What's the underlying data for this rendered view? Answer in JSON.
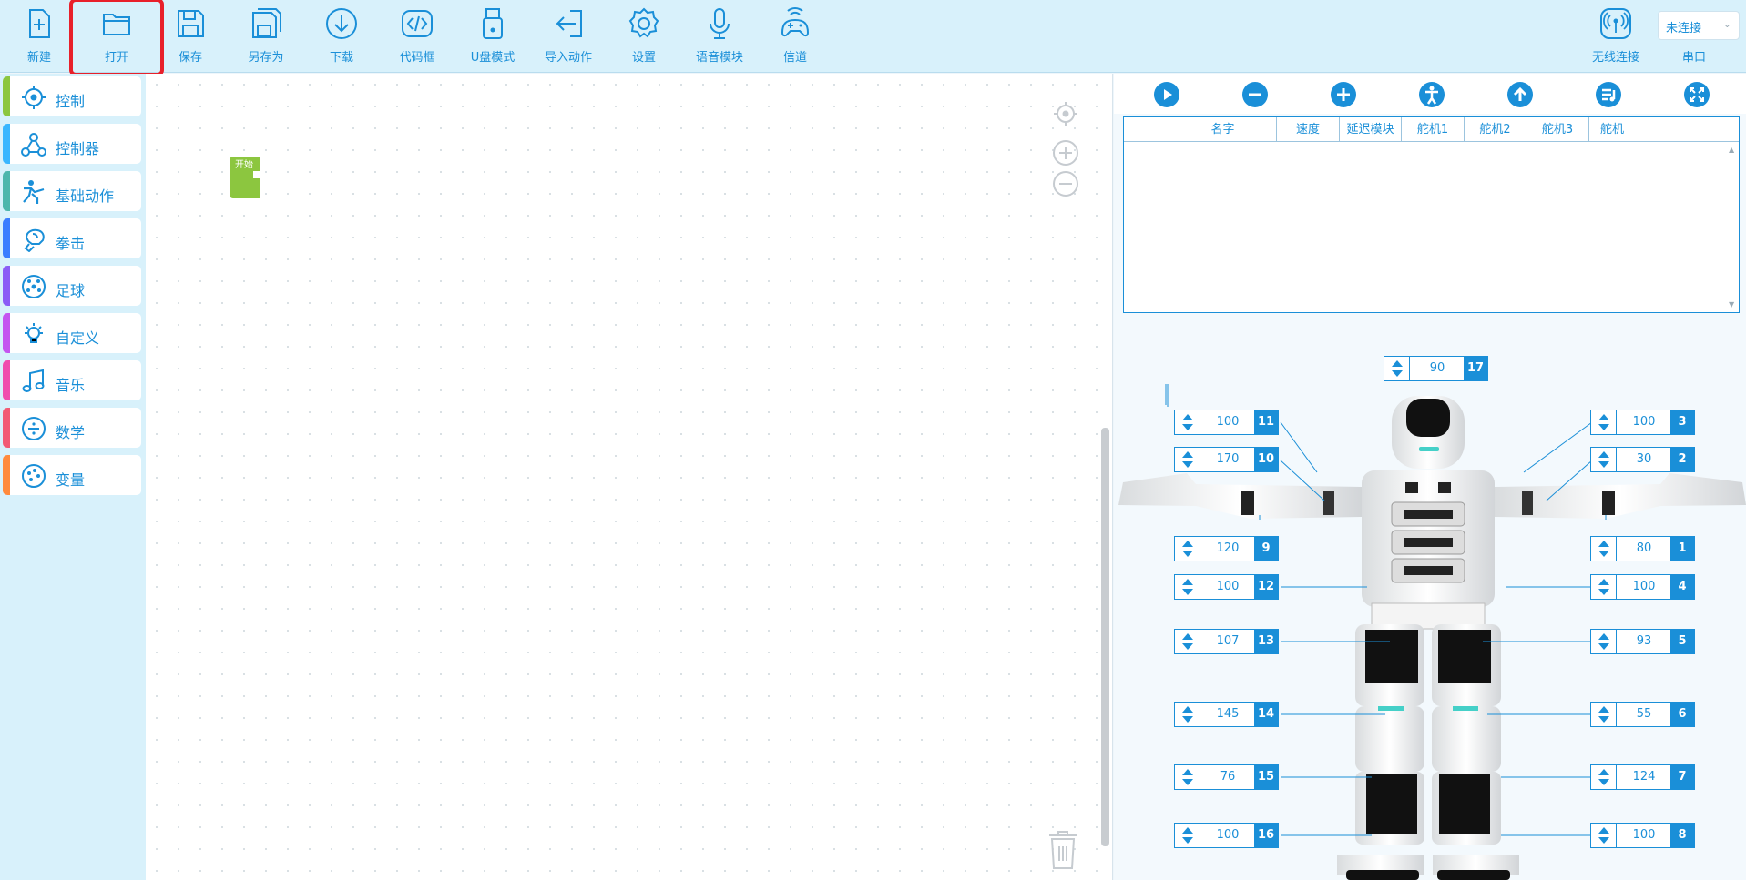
{
  "toolbar": {
    "new_label": "新建",
    "open_label": "打开",
    "save_label": "保存",
    "save_as_label": "另存为",
    "download_label": "下载",
    "code_label": "代码框",
    "usb_label": "U盘模式",
    "import_label": "导入动作",
    "settings_label": "设置",
    "voice_label": "语音模块",
    "channel_label": "信道",
    "wireless_label": "无线连接",
    "connection_value": "未连接",
    "serial_label": "串口"
  },
  "sidebar": {
    "items": [
      {
        "label": "控制",
        "color": "#8cc63f"
      },
      {
        "label": "控制器",
        "color": "#38b6ff"
      },
      {
        "label": "基础动作",
        "color": "#4db6ac"
      },
      {
        "label": "拳击",
        "color": "#3a7dff"
      },
      {
        "label": "足球",
        "color": "#8a5cf6"
      },
      {
        "label": "自定义",
        "color": "#c455f0"
      },
      {
        "label": "音乐",
        "color": "#f04dae"
      },
      {
        "label": "数学",
        "color": "#f25a74"
      },
      {
        "label": "变量",
        "color": "#ff8a3d"
      }
    ]
  },
  "workspace": {
    "start_block_label": "开始"
  },
  "action_table": {
    "columns": [
      "",
      "名字",
      "速度",
      "延迟模块",
      "舵机1",
      "舵机2",
      "舵机3",
      "舵机"
    ]
  },
  "servos": {
    "s17": {
      "id": "17",
      "value": "90"
    },
    "s11": {
      "id": "11",
      "value": "100"
    },
    "s10": {
      "id": "10",
      "value": "170"
    },
    "s9": {
      "id": "9",
      "value": "120"
    },
    "s12": {
      "id": "12",
      "value": "100"
    },
    "s13": {
      "id": "13",
      "value": "107"
    },
    "s14": {
      "id": "14",
      "value": "145"
    },
    "s15": {
      "id": "15",
      "value": "76"
    },
    "s16": {
      "id": "16",
      "value": "100"
    },
    "s3": {
      "id": "3",
      "value": "100"
    },
    "s2": {
      "id": "2",
      "value": "30"
    },
    "s1": {
      "id": "1",
      "value": "80"
    },
    "s4": {
      "id": "4",
      "value": "100"
    },
    "s5": {
      "id": "5",
      "value": "93"
    },
    "s6": {
      "id": "6",
      "value": "55"
    },
    "s7": {
      "id": "7",
      "value": "124"
    },
    "s8": {
      "id": "8",
      "value": "100"
    }
  },
  "colors": {
    "accent": "#1a8fd8",
    "highlight": "#e8202a",
    "start_block": "#8cc63f"
  }
}
